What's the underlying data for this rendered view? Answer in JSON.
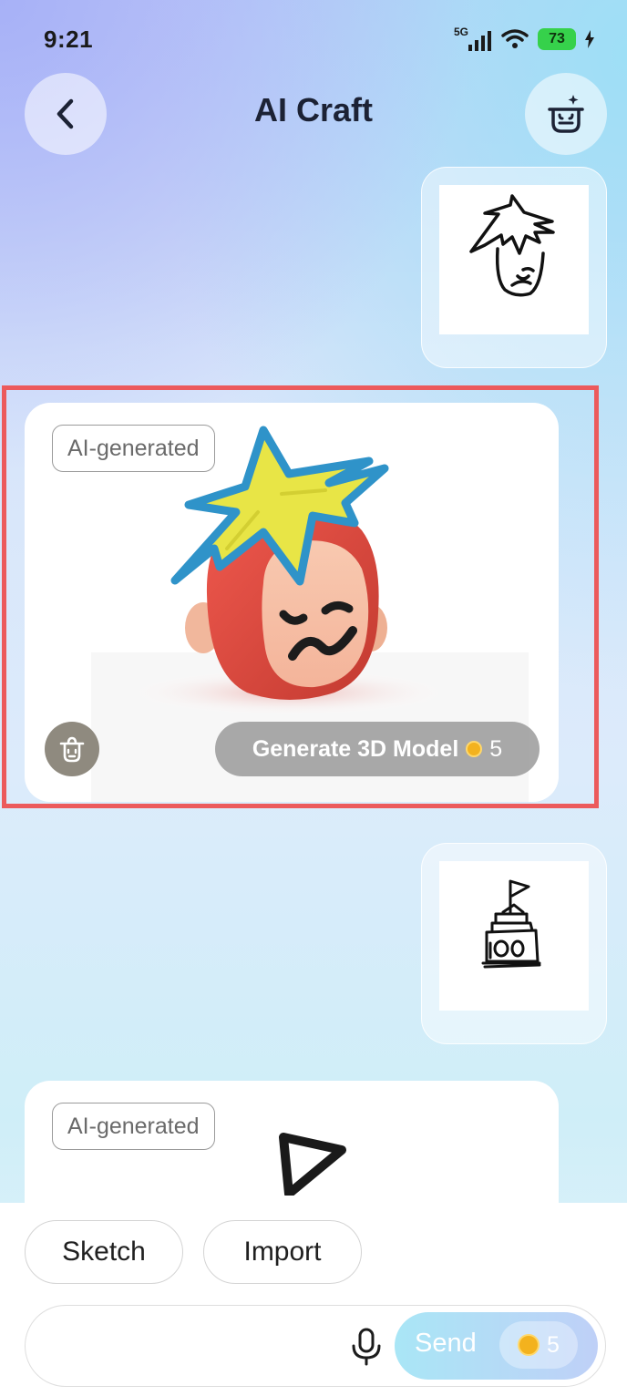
{
  "status_bar": {
    "time": "9:21",
    "network": "5G",
    "battery": "73",
    "icons": [
      "signal-icon",
      "wifi-icon",
      "battery-icon",
      "charging-icon"
    ]
  },
  "header": {
    "title": "AI Craft",
    "back_icon": "chevron-left-icon",
    "right_icon": "craft-pot-icon"
  },
  "messages": [
    {
      "role": "user",
      "type": "sketch",
      "subject": "spiky-hair-face"
    },
    {
      "role": "ai",
      "badge": "AI-generated",
      "action_label": "Generate 3D Model",
      "cost": "5",
      "delete_icon": "trash-icon"
    },
    {
      "role": "user",
      "type": "sketch",
      "subject": "stacked-tower-with-flag"
    },
    {
      "role": "ai",
      "badge": "AI-generated"
    }
  ],
  "composer": {
    "chips": [
      "Sketch",
      "Import"
    ],
    "input_value": "",
    "input_placeholder": "",
    "send_label": "Send",
    "send_cost": "5"
  },
  "colors": {
    "selection": "#ec5a5c",
    "battery": "#36d14b",
    "coin": "#f3b21e"
  }
}
